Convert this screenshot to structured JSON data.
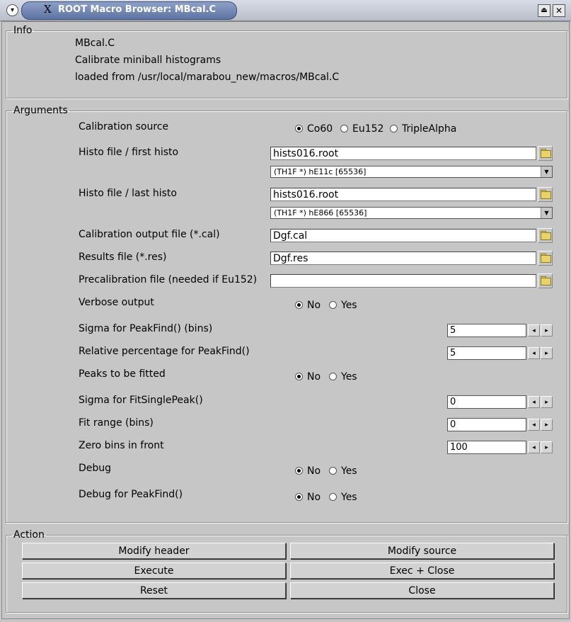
{
  "window": {
    "title": "ROOT Macro Browser: MBcal.C",
    "logo": "X"
  },
  "info": {
    "legend": "Info",
    "macro": "MBcal.C",
    "description": "Calibrate miniball histograms",
    "loaded": "loaded from /usr/local/marabou_new/macros/MBcal.C"
  },
  "arguments": {
    "legend": "Arguments",
    "calib_source": {
      "label": "Calibration source",
      "options": [
        "Co60",
        "Eu152",
        "TripleAlpha"
      ],
      "selected": "Co60"
    },
    "first_histo": {
      "label": "Histo file / first histo",
      "file": "hists016.root",
      "histo": "(TH1F *) hE11c [65536]"
    },
    "last_histo": {
      "label": "Histo file / last histo",
      "file": "hists016.root",
      "histo": "(TH1F *) hE866 [65536]"
    },
    "cal_out": {
      "label": "Calibration output file (*.cal)",
      "value": "Dgf.cal"
    },
    "results": {
      "label": "Results file (*.res)",
      "value": "Dgf.res"
    },
    "precal": {
      "label": "Precalibration file (needed if Eu152)",
      "value": ""
    },
    "verbose": {
      "label": "Verbose output",
      "no": "No",
      "yes": "Yes",
      "selected": "No"
    },
    "sigma_peakfind": {
      "label": "Sigma for PeakFind() (bins)",
      "value": "5"
    },
    "rel_pct": {
      "label": "Relative percentage for PeakFind()",
      "value": "5"
    },
    "peaks_fitted": {
      "label": "Peaks to be fitted",
      "no": "No",
      "yes": "Yes",
      "selected": "No"
    },
    "sigma_fit": {
      "label": "Sigma for FitSinglePeak()",
      "value": "0"
    },
    "fit_range": {
      "label": "Fit range (bins)",
      "value": "0"
    },
    "zero_bins": {
      "label": "Zero bins in front",
      "value": "100"
    },
    "debug": {
      "label": "Debug",
      "no": "No",
      "yes": "Yes",
      "selected": "No"
    },
    "debug_pf": {
      "label": "Debug for PeakFind()",
      "no": "No",
      "yes": "Yes",
      "selected": "No"
    }
  },
  "action": {
    "legend": "Action",
    "modify_header": "Modify header",
    "modify_source": "Modify source",
    "execute": "Execute",
    "exec_close": "Exec + Close",
    "reset": "Reset",
    "close": "Close"
  },
  "icons": {
    "window_menu": "chevron-down-icon",
    "folder": "folder-icon",
    "shade": "eject-icon",
    "close": "close-icon"
  }
}
